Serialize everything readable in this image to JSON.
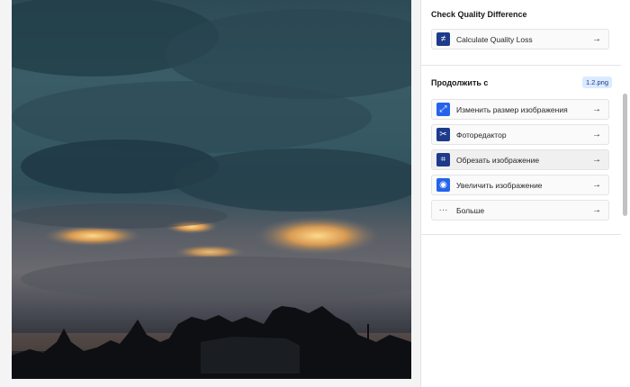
{
  "quality": {
    "title": "Check Quality Difference",
    "action": {
      "label": "Calculate Quality Loss",
      "icon": "not-equal-icon",
      "glyph": "≠"
    }
  },
  "continue": {
    "title": "Продолжить с",
    "file": "1.2.png",
    "actions": [
      {
        "label": "Изменить размер изображения",
        "icon": "resize-icon",
        "glyph": "⤢"
      },
      {
        "label": "Фоторедактор",
        "icon": "photo-editor-icon",
        "glyph": "✂"
      },
      {
        "label": "Обрезать изображение",
        "icon": "crop-icon",
        "glyph": "⌗"
      },
      {
        "label": "Увеличить изображение",
        "icon": "eye-icon",
        "glyph": "◉"
      },
      {
        "label": "Больше",
        "icon": "more-icon",
        "glyph": "···"
      }
    ]
  },
  "arrow_glyph": "→",
  "colors": {
    "accent": "#1e3a8a",
    "accent_light": "#2563eb",
    "badge_bg": "#dbeafe"
  }
}
